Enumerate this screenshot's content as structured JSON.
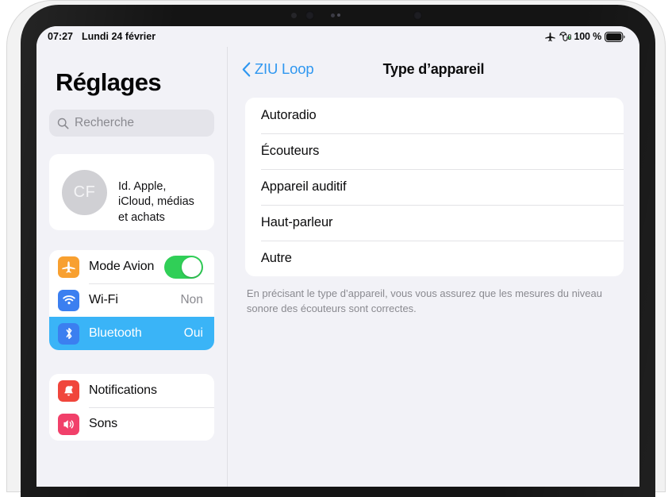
{
  "status_bar": {
    "time": "07:27",
    "date": "Lundi 24 février",
    "airplane_icon": "airplane-icon",
    "headphones_icon": "headphones-battery-icon",
    "battery_percent": "100 %",
    "battery_icon": "battery-full-icon"
  },
  "sidebar": {
    "title": "Réglages",
    "search": {
      "icon": "search-icon",
      "placeholder": "Recherche"
    },
    "account": {
      "initials": "CF",
      "label": "Id. Apple, iCloud, médias et achats"
    },
    "groups": [
      {
        "rows": [
          {
            "label": "Mode Avion",
            "icon": "airplane-icon",
            "icon_color": "#f8a030",
            "control": "toggle",
            "toggle_on": true,
            "value": ""
          },
          {
            "label": "Wi-Fi",
            "icon": "wifi-icon",
            "icon_color": "#3b7ff0",
            "control": "value",
            "value": "Non"
          },
          {
            "label": "Bluetooth",
            "icon": "bluetooth-icon",
            "icon_color": "#3b7ff0",
            "control": "value",
            "value": "Oui",
            "selected": true
          }
        ]
      },
      {
        "rows": [
          {
            "label": "Notifications",
            "icon": "bell-icon",
            "icon_color": "#f0463c",
            "control": "none",
            "value": ""
          },
          {
            "label": "Sons",
            "icon": "speaker-icon",
            "icon_color": "#f1406a",
            "control": "none",
            "value": ""
          }
        ]
      }
    ]
  },
  "detail": {
    "back_label": "ZIU Loop",
    "back_icon": "chevron-left-icon",
    "title": "Type d’appareil",
    "options": [
      {
        "label": "Autoradio"
      },
      {
        "label": "Écouteurs"
      },
      {
        "label": "Appareil auditif"
      },
      {
        "label": "Haut-parleur"
      },
      {
        "label": "Autre"
      }
    ],
    "footer": "En précisant le type d’appareil, vous vous assurez que les mesures du niveau sonore des écouteurs sont correctes."
  },
  "colors": {
    "accent_blue": "#2f97f0",
    "selection_blue": "#3ab4f7",
    "toggle_green": "#30cf57",
    "background": "#f2f2f7",
    "card": "#ffffff"
  }
}
